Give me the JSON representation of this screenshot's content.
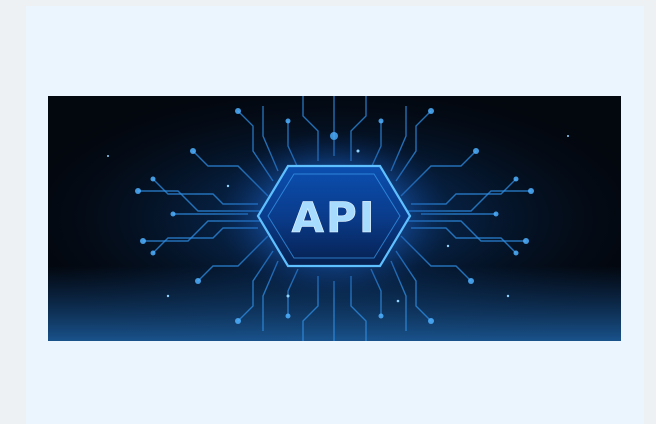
{
  "banner": {
    "text": "API",
    "icon": "api-chip-circuit-illustration",
    "colors": {
      "background": "#03070e",
      "glow": "#1f8cff",
      "text": "#a8dcff",
      "circuit": "#2f8fe6"
    }
  }
}
